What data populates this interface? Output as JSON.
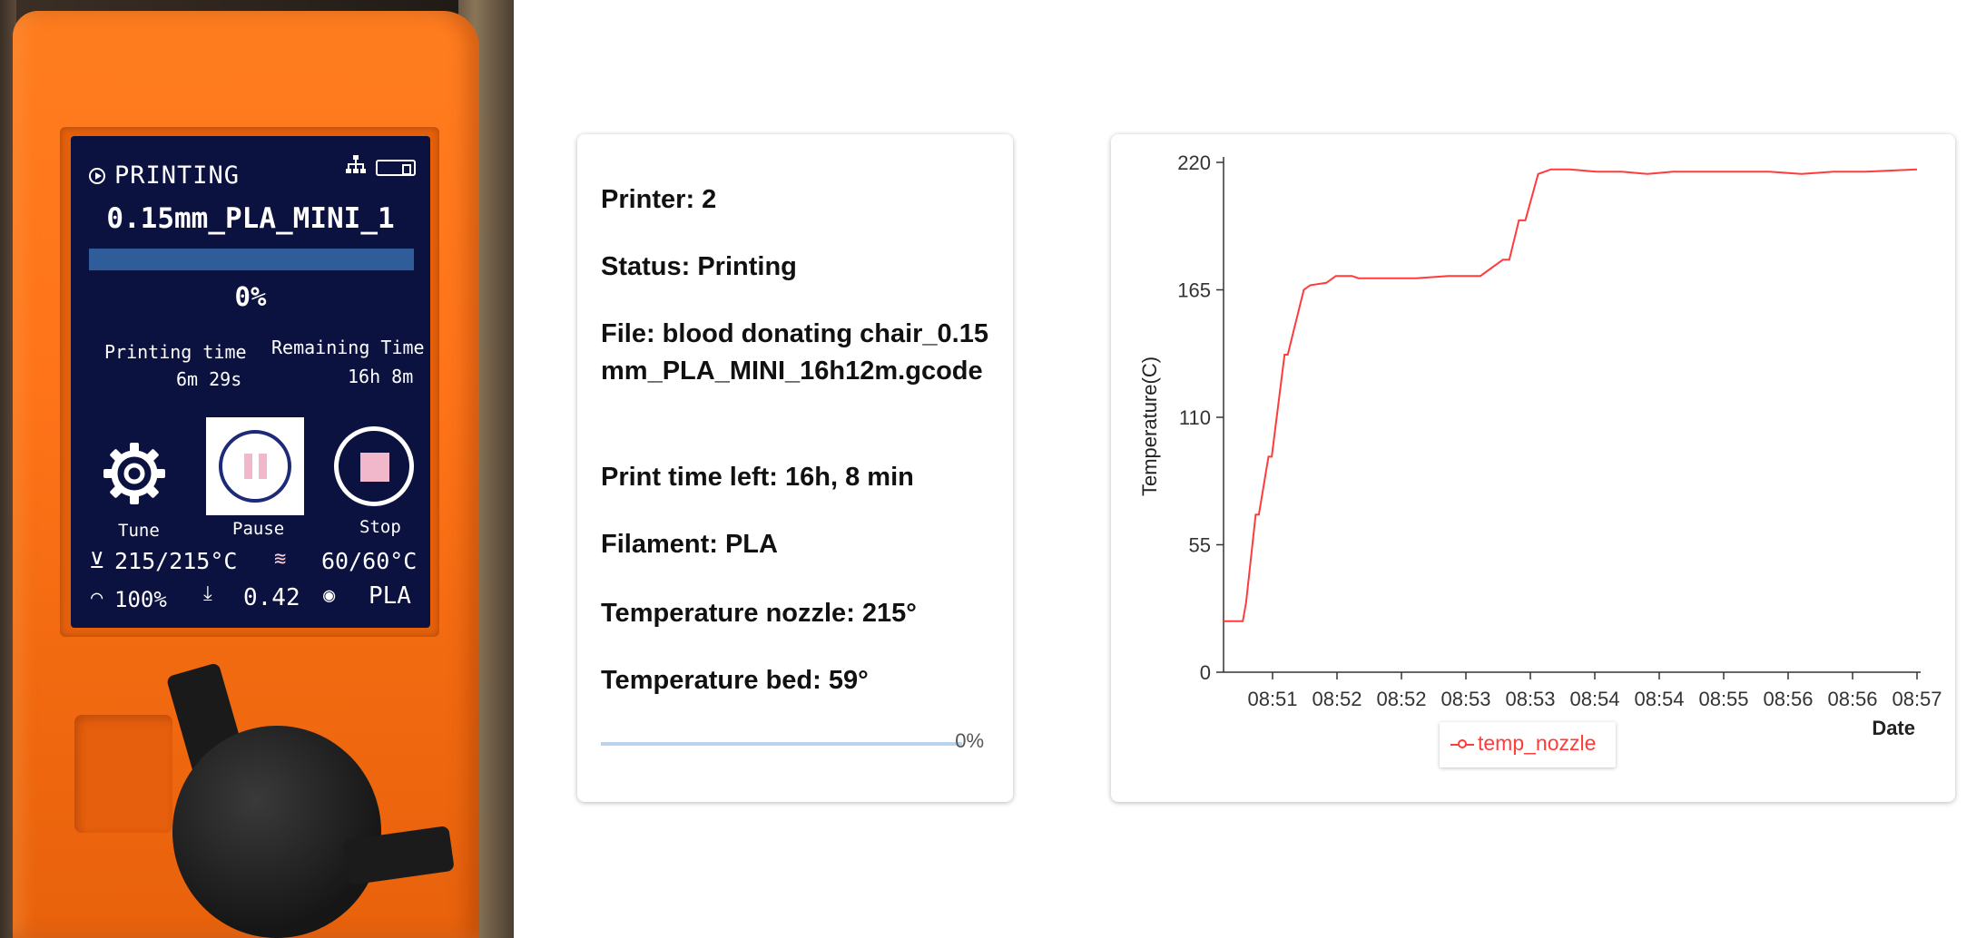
{
  "lcd": {
    "status": "PRINTING",
    "filename": "0.15mm_PLA_MINI_1",
    "progress_pct": 0,
    "progress_text": "0%",
    "printing_time_label": "Printing time",
    "printing_time_value": "6m 29s",
    "remaining_time_label": "Remaining Time",
    "remaining_time_value": "16h  8m",
    "tune_label": "Tune",
    "pause_label": "Pause",
    "stop_label": "Stop",
    "nozzle_temp": "215/215°C",
    "bed_temp": "60/60°C",
    "speed": "100%",
    "z_height": "0.42",
    "filament": "PLA",
    "icons": [
      "play-icon",
      "network-icon",
      "usb-icon",
      "gear-icon",
      "pause-icon",
      "stop-icon",
      "nozzle-icon",
      "heatbed-icon",
      "speed-icon",
      "z-axis-icon",
      "filament-icon"
    ]
  },
  "info": {
    "printer": "Printer: 2",
    "status": "Status: Printing",
    "file": "File: blood donating chair_0.15mm_PLA_MINI_16h12m.gcode",
    "time_left": "Print time left: 16h, 8 min",
    "filament": "Filament: PLA",
    "temp_nozzle": "Temperature nozzle: 215°",
    "temp_bed": "Temperature bed: 59°",
    "progress_pct": 0,
    "progress_text": "0%"
  },
  "chart_data": {
    "type": "line",
    "xlabel": "Date",
    "ylabel": "Temperature(C)",
    "ylim": [
      0,
      220
    ],
    "yticks": [
      0,
      55,
      110,
      165,
      220
    ],
    "xticks": [
      "08:51",
      "08:52",
      "08:52",
      "08:53",
      "08:53",
      "08:54",
      "08:54",
      "08:55",
      "08:56",
      "08:56",
      "08:57"
    ],
    "grid": false,
    "legend_position": "bottom",
    "accent_color": "#ff3b3b",
    "series": [
      {
        "name": "temp_nozzle",
        "x": [
          0,
          0.3,
          0.35,
          0.5,
          0.55,
          0.7,
          0.75,
          0.95,
          1.0,
          1.25,
          1.35,
          1.6,
          1.75,
          2.0,
          2.1,
          2.3,
          2.6,
          3.0,
          3.5,
          4.0,
          4.35,
          4.45,
          4.6,
          4.7,
          4.9,
          5.1,
          5.4,
          5.8,
          6.2,
          6.6,
          7.0,
          7.5,
          8.0,
          8.5,
          9.0,
          9.5,
          10.0,
          10.8
        ],
        "y": [
          22,
          22,
          30,
          68,
          68,
          93,
          93,
          137,
          137,
          165,
          167,
          168,
          171,
          171,
          170,
          170,
          170,
          170,
          171,
          171,
          178,
          178,
          195,
          195,
          215,
          217,
          217,
          216,
          216,
          215,
          216,
          216,
          216,
          216,
          215,
          216,
          216,
          217
        ]
      }
    ]
  }
}
